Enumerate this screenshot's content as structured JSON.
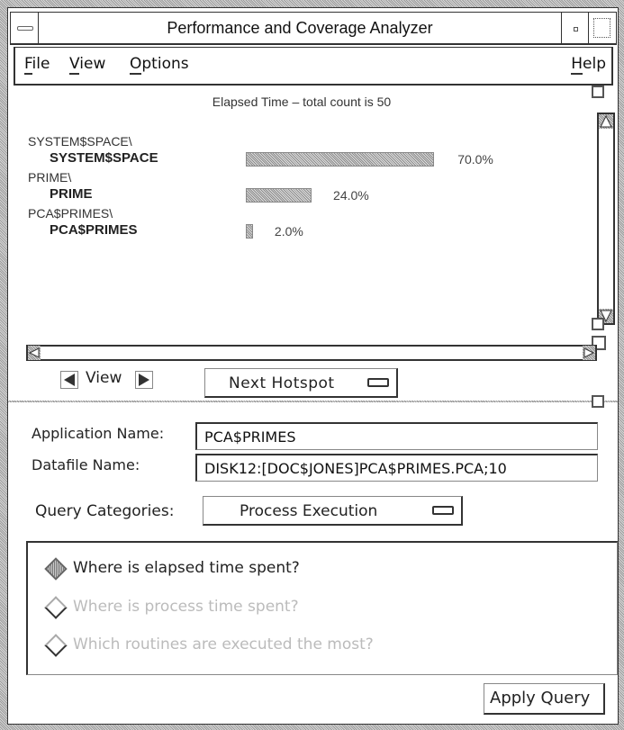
{
  "window": {
    "title": "Performance and Coverage Analyzer"
  },
  "menubar": {
    "items": [
      {
        "label": "File",
        "mnemonic": "F",
        "rest": "ile"
      },
      {
        "label": "View",
        "mnemonic": "V",
        "rest": "iew"
      },
      {
        "label": "Options",
        "mnemonic": "O",
        "rest": "ptions"
      }
    ],
    "help": {
      "label": "Help",
      "mnemonic": "H",
      "rest": "elp"
    }
  },
  "histogram": {
    "title": "Elapsed Time – total count is 50",
    "rows": [
      {
        "path": "SYSTEM$SPACE\\",
        "name": "SYSTEM$SPACE",
        "percent": 70.0,
        "label": "70.0%"
      },
      {
        "path": "PRIME\\",
        "name": "PRIME",
        "percent": 24.0,
        "label": "24.0%"
      },
      {
        "path": "PCA$PRIMES\\",
        "name": "PCA$PRIMES",
        "percent": 2.0,
        "label": "2.0%"
      }
    ]
  },
  "nav": {
    "view_label": "View",
    "hotspot_label": "Next Hotspot"
  },
  "form": {
    "app_name_label": "Application Name:",
    "app_name_value": "PCA$PRIMES",
    "datafile_label": "Datafile Name:",
    "datafile_value": "DISK12:[DOC$JONES]PCA$PRIMES.PCA;10",
    "query_cat_label": "Query Categories:",
    "query_cat_value": "Process Execution"
  },
  "queries": [
    {
      "label": "Where is elapsed time spent?",
      "selected": true,
      "enabled": true
    },
    {
      "label": "Where is process time spent?",
      "selected": false,
      "enabled": false
    },
    {
      "label": "Which routines are executed the most?",
      "selected": false,
      "enabled": false
    }
  ],
  "apply_label": "Apply Query"
}
